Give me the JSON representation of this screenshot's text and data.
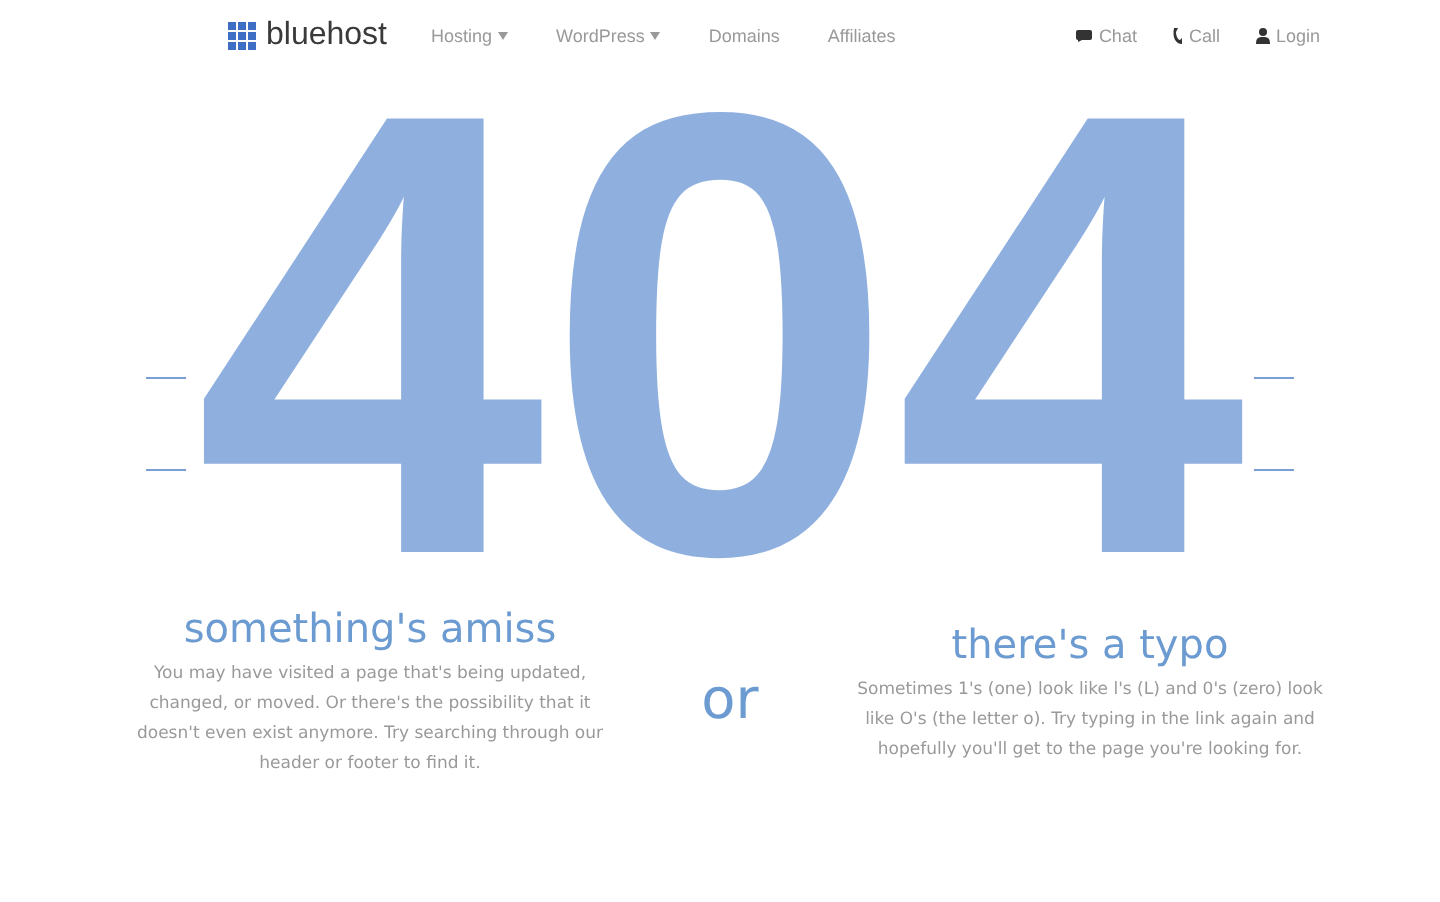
{
  "nav": {
    "logo": "bluehost",
    "items": [
      {
        "label": "Hosting",
        "has_menu": true
      },
      {
        "label": "WordPress",
        "has_menu": true
      },
      {
        "label": "Domains",
        "has_menu": false
      },
      {
        "label": "Affiliates",
        "has_menu": false
      }
    ],
    "actions": [
      {
        "kind": "chat",
        "label": "Chat"
      },
      {
        "kind": "call",
        "label": "Call"
      },
      {
        "kind": "login",
        "label": "Login"
      }
    ]
  },
  "code": "404",
  "left": {
    "heading": "something's amiss",
    "text": "You may have visited a page that's being updated, changed, or moved. Or there's the possibility that it doesn't even exist anymore. Try searching through our header or footer to find it."
  },
  "separator": "or",
  "right": {
    "heading": "there's a typo",
    "text": "Sometimes 1's (one) look like l's (L) and 0's (zero) look like O's (the letter o). Try typing in the link again and hopefully you'll get to the page you're looking for."
  }
}
